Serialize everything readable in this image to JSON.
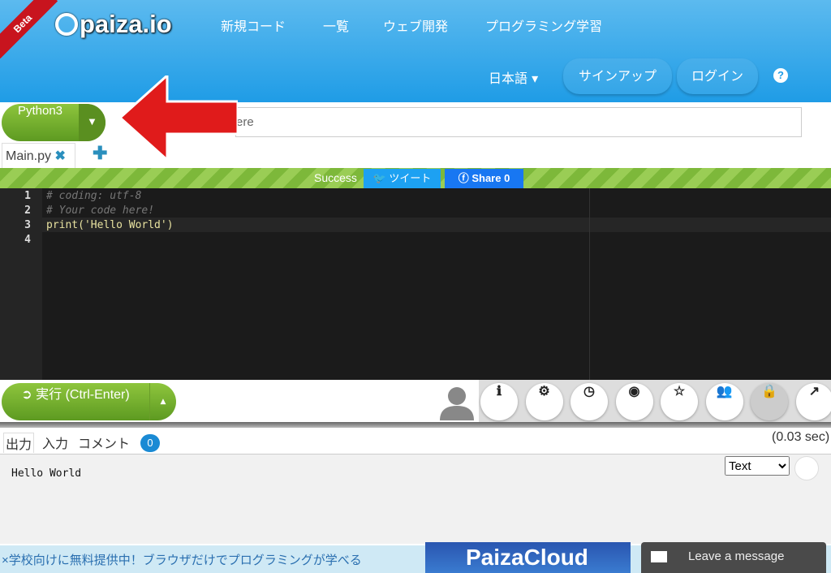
{
  "header": {
    "beta": "Beta",
    "logo": "paiza.io",
    "nav": [
      "新規コード",
      "一覧",
      "ウェブ開発",
      "プログラミング学習"
    ],
    "language": "日本語 ▾",
    "signup": "サインアップ",
    "login": "ログイン",
    "help": "?"
  },
  "toolbar": {
    "language": "Python3",
    "title_placeholder": "ere"
  },
  "tabs": {
    "file": "Main.py",
    "close": "✖",
    "add": "✚"
  },
  "status": {
    "text": "Success",
    "tweet": "ツイート",
    "share": "Share 0"
  },
  "editor": {
    "lines": [
      {
        "n": "1",
        "code": "# coding: utf-8",
        "comment": true
      },
      {
        "n": "2",
        "code": "# Your code here!",
        "comment": true
      },
      {
        "n": "3",
        "code": "print('Hello World')",
        "comment": false
      },
      {
        "n": "4",
        "code": "",
        "comment": false
      }
    ]
  },
  "run": {
    "label": "➲ 実行 (Ctrl-Enter)",
    "dropdown": "▲"
  },
  "icons": [
    "info-icon",
    "gear-icon",
    "clock-icon",
    "github-icon",
    "star-icon",
    "group-icon",
    "lock-icon",
    "share-icon"
  ],
  "output": {
    "tabs": [
      "出力",
      "入力",
      "コメント"
    ],
    "comment_count": "0",
    "time": "(0.03 sec)",
    "text": "Hello World",
    "format": "Text"
  },
  "banner": {
    "text": "×学校向けに無料提供中！ブラウザだけでプログラミングが学べる",
    "cloud": "PaizaCloud",
    "message": "Leave a message"
  },
  "colors": {
    "header": "#1f9ce6",
    "green": "#6fae2c",
    "arrow": "#e01b1b"
  }
}
